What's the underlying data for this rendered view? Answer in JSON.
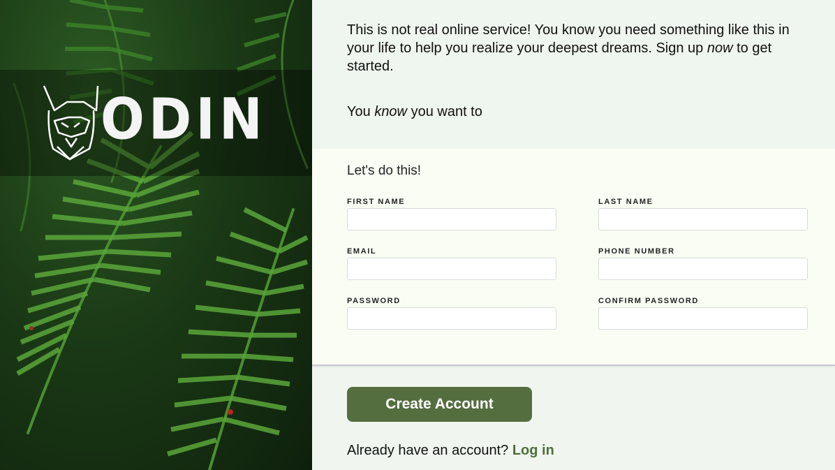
{
  "brand": {
    "logo_text": "ODIN",
    "mascot_icon": "viking-helmet-dog-icon"
  },
  "intro": {
    "line_pre": "This is not real online service! You know you need something like this in your life to help you realize your deepest dreams. Sign up ",
    "line_em": "now",
    "line_post": " to get started.",
    "sub_pre": "You ",
    "sub_em": "know",
    "sub_post": " you want to"
  },
  "form": {
    "title": "Let's do this!",
    "fields": {
      "first_name": {
        "label": "FIRST NAME",
        "value": ""
      },
      "last_name": {
        "label": "LAST NAME",
        "value": ""
      },
      "email": {
        "label": "EMAIL",
        "value": ""
      },
      "phone": {
        "label": "PHONE NUMBER",
        "value": ""
      },
      "password": {
        "label": "PASSWORD",
        "value": ""
      },
      "confirm_password": {
        "label": "CONFIRM PASSWORD",
        "value": ""
      }
    }
  },
  "actions": {
    "create_label": "Create Account",
    "login_prompt": "Already have an account?",
    "login_link": "Log in"
  },
  "colors": {
    "accent": "#556e40",
    "link": "#4f6d3a",
    "panel_bg": "#f0f6ef",
    "form_bg": "#fafdf4"
  }
}
